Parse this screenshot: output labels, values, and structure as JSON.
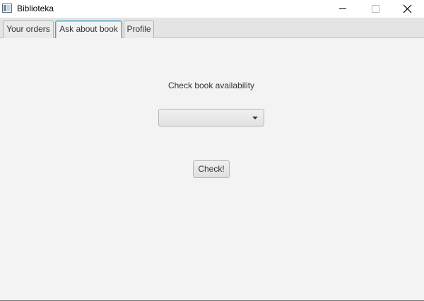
{
  "window": {
    "title": "Biblioteka",
    "icon": "app-window-icon",
    "controls": {
      "minimize_icon": "minimize-icon",
      "maximize_icon": "maximize-icon",
      "close_icon": "close-icon"
    }
  },
  "tabs": [
    {
      "label": "Your orders",
      "selected": false
    },
    {
      "label": "Ask about book",
      "selected": true
    },
    {
      "label": "Profile",
      "selected": false
    }
  ],
  "main": {
    "heading": "Check book availability",
    "book_select": {
      "value": "",
      "arrow_icon": "chevron-down-icon"
    },
    "check_button_label": "Check!"
  },
  "colors": {
    "selected_tab_border": "#3fa3d6",
    "background": "#f3f3f3"
  }
}
